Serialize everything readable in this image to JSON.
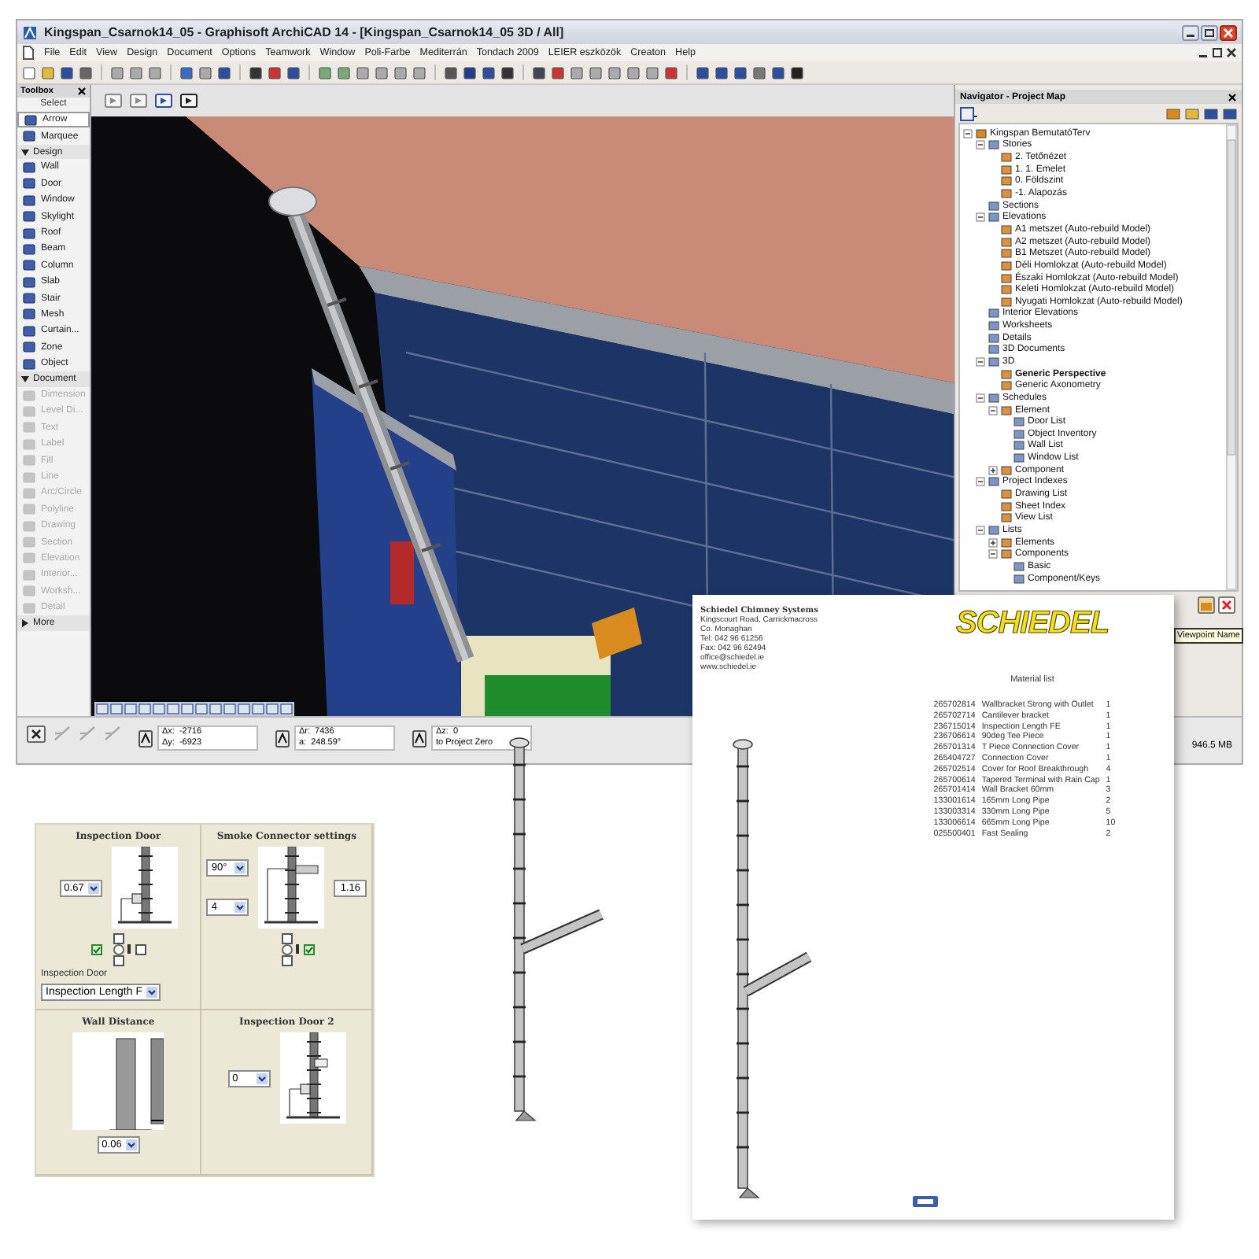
{
  "window": {
    "title": "Kingspan_Csarnok14_05 - Graphisoft ArchiCAD 14 - [Kingspan_Csarnok14_05 3D / All]",
    "menu": [
      "File",
      "Edit",
      "View",
      "Design",
      "Document",
      "Options",
      "Teamwork",
      "Window",
      "Poli-Farbe",
      "Mediterrán",
      "Tondach 2009",
      "LEIER eszközök",
      "Creaton",
      "Help"
    ]
  },
  "toolbox": {
    "title": "Toolbox",
    "items": [
      {
        "kind": "header",
        "label": "Select"
      },
      {
        "kind": "tool",
        "label": "Arrow",
        "selected": true,
        "disabled": false
      },
      {
        "kind": "tool",
        "label": "Marquee",
        "selected": false,
        "disabled": false
      },
      {
        "kind": "section",
        "label": "Design",
        "expanded": true
      },
      {
        "kind": "tool",
        "label": "Wall",
        "selected": false,
        "disabled": false
      },
      {
        "kind": "tool",
        "label": "Door",
        "selected": false,
        "disabled": false
      },
      {
        "kind": "tool",
        "label": "Window",
        "selected": false,
        "disabled": false
      },
      {
        "kind": "tool",
        "label": "Skylight",
        "selected": false,
        "disabled": false
      },
      {
        "kind": "tool",
        "label": "Roof",
        "selected": false,
        "disabled": false
      },
      {
        "kind": "tool",
        "label": "Beam",
        "selected": false,
        "disabled": false
      },
      {
        "kind": "tool",
        "label": "Column",
        "selected": false,
        "disabled": false
      },
      {
        "kind": "tool",
        "label": "Slab",
        "selected": false,
        "disabled": false
      },
      {
        "kind": "tool",
        "label": "Stair",
        "selected": false,
        "disabled": false
      },
      {
        "kind": "tool",
        "label": "Mesh",
        "selected": false,
        "disabled": false
      },
      {
        "kind": "tool",
        "label": "Curtain...",
        "selected": false,
        "disabled": false
      },
      {
        "kind": "tool",
        "label": "Zone",
        "selected": false,
        "disabled": false
      },
      {
        "kind": "tool",
        "label": "Object",
        "selected": false,
        "disabled": false
      },
      {
        "kind": "section",
        "label": "Document",
        "expanded": true
      },
      {
        "kind": "tool",
        "label": "Dimension",
        "selected": false,
        "disabled": true
      },
      {
        "kind": "tool",
        "label": "Level Di...",
        "selected": false,
        "disabled": true
      },
      {
        "kind": "tool",
        "label": "Text",
        "selected": false,
        "disabled": true
      },
      {
        "kind": "tool",
        "label": "Label",
        "selected": false,
        "disabled": true
      },
      {
        "kind": "tool",
        "label": "Fill",
        "selected": false,
        "disabled": true
      },
      {
        "kind": "tool",
        "label": "Line",
        "selected": false,
        "disabled": true
      },
      {
        "kind": "tool",
        "label": "Arc/Circle",
        "selected": false,
        "disabled": true
      },
      {
        "kind": "tool",
        "label": "Polyline",
        "selected": false,
        "disabled": true
      },
      {
        "kind": "tool",
        "label": "Drawing",
        "selected": false,
        "disabled": true
      },
      {
        "kind": "tool",
        "label": "Section",
        "selected": false,
        "disabled": true
      },
      {
        "kind": "tool",
        "label": "Elevation",
        "selected": false,
        "disabled": true
      },
      {
        "kind": "tool",
        "label": "Interior...",
        "selected": false,
        "disabled": true
      },
      {
        "kind": "tool",
        "label": "Worksh...",
        "selected": false,
        "disabled": true
      },
      {
        "kind": "tool",
        "label": "Detail",
        "selected": false,
        "disabled": true
      },
      {
        "kind": "section",
        "label": "More",
        "expanded": false
      }
    ]
  },
  "navigator": {
    "title": "Navigator - Project Map",
    "tree": [
      {
        "label": "Kingspan BemutatóTerv",
        "expanded": true,
        "selected": false,
        "children": [
          {
            "label": "Stories",
            "expanded": true,
            "selected": false,
            "children": [
              {
                "label": "2. Tetőnézet",
                "selected": false
              },
              {
                "label": "1. 1. Emelet",
                "selected": false
              },
              {
                "label": "0. Földszint",
                "selected": false
              },
              {
                "label": "-1. Alapozás",
                "selected": false
              }
            ]
          },
          {
            "label": "Sections",
            "selected": false
          },
          {
            "label": "Elevations",
            "expanded": true,
            "selected": false,
            "children": [
              {
                "label": "A1 metszet (Auto-rebuild Model)",
                "selected": false
              },
              {
                "label": "A2 metszet (Auto-rebuild Model)",
                "selected": false
              },
              {
                "label": "B1 Metszet (Auto-rebuild Model)",
                "selected": false
              },
              {
                "label": "Déli Homlokzat (Auto-rebuild Model)",
                "selected": false
              },
              {
                "label": "Északi Homlokzat (Auto-rebuild Model)",
                "selected": false
              },
              {
                "label": "Keleti Homlokzat (Auto-rebuild Model)",
                "selected": false
              },
              {
                "label": "Nyugati Homlokzat (Auto-rebuild Model)",
                "selected": false
              }
            ]
          },
          {
            "label": "Interior Elevations",
            "selected": false
          },
          {
            "label": "Worksheets",
            "selected": false
          },
          {
            "label": "Details",
            "selected": false
          },
          {
            "label": "3D Documents",
            "selected": false
          },
          {
            "label": "3D",
            "expanded": true,
            "selected": false,
            "children": [
              {
                "label": "Generic Perspective",
                "selected": true
              },
              {
                "label": "Generic Axonometry",
                "selected": false
              }
            ]
          },
          {
            "label": "Schedules",
            "expanded": true,
            "selected": false,
            "children": [
              {
                "label": "Element",
                "expanded": true,
                "selected": false,
                "children": [
                  {
                    "label": "Door List",
                    "selected": false
                  },
                  {
                    "label": "Object Inventory",
                    "selected": false
                  },
                  {
                    "label": "Wall List",
                    "selected": false
                  },
                  {
                    "label": "Window List",
                    "selected": false
                  }
                ]
              },
              {
                "label": "Component",
                "expanded": false,
                "selected": false
              }
            ]
          },
          {
            "label": "Project Indexes",
            "expanded": true,
            "selected": false,
            "children": [
              {
                "label": "Drawing List",
                "selected": false
              },
              {
                "label": "Sheet Index",
                "selected": false
              },
              {
                "label": "View List",
                "selected": false
              }
            ]
          },
          {
            "label": "Lists",
            "expanded": true,
            "selected": false,
            "children": [
              {
                "label": "Elements",
                "expanded": false,
                "selected": false
              },
              {
                "label": "Components",
                "expanded": true,
                "selected": false,
                "children": [
                  {
                    "label": "Basic",
                    "selected": false
                  },
                  {
                    "label": "Component/Keys",
                    "selected": false
                  }
                ]
              }
            ]
          }
        ]
      }
    ],
    "tooltip": "Viewpoint Name"
  },
  "status_bar": {
    "coords": [
      [
        {
          "label": "Δx:",
          "value": "-2716"
        },
        {
          "label": "Δy:",
          "value": "-6923"
        }
      ],
      [
        {
          "label": "Δr:",
          "value": "7436"
        },
        {
          "label": "a:",
          "value": "248.59°"
        }
      ],
      [
        {
          "label": "Δz:",
          "value": "0"
        },
        {
          "label": "to Project Zero"
        }
      ]
    ],
    "memory": "946.5 MB"
  },
  "settings_panel": {
    "sections": [
      {
        "kind": "door",
        "title": "Inspection Door",
        "dropdowns": [
          "0.67"
        ],
        "checkboxes": [
          {
            "kind": "top",
            "checked": false
          },
          {
            "kind": "left",
            "checked": true
          },
          {
            "kind": "right",
            "checked": false
          },
          {
            "kind": "bottom",
            "checked": false
          }
        ],
        "radio_selected": false,
        "label": "Inspection Door",
        "select": "Inspection Length F"
      },
      {
        "kind": "connector",
        "title": "Smoke Connector settings",
        "dropdowns": [
          "90°",
          "4"
        ],
        "field": "1.16",
        "checkboxes": [
          {
            "kind": "top",
            "checked": false
          },
          {
            "kind": "right",
            "checked": true
          },
          {
            "kind": "bottom",
            "checked": false
          }
        ],
        "radio_selected": false
      },
      {
        "kind": "wall",
        "title": "Wall Distance",
        "dropdowns": [
          "0.06"
        ]
      },
      {
        "kind": "door2",
        "title": "Inspection Door 2",
        "dropdowns": [
          "0"
        ]
      }
    ]
  },
  "document": {
    "address": [
      "Schiedel Chimney Systems",
      "Kingscourt Road, Carrickmacross",
      "Co. Monaghan",
      "Tel: 042 96 61256",
      "Fax: 042 96 62494",
      "office@schiedel.ie",
      "www.schiedel.ie"
    ],
    "logo": "SCHIEDEL",
    "list_title": "Material list",
    "rows": [
      [
        "265702814",
        "Wallbracket Strong with Outlet",
        "1"
      ],
      [
        "265702714",
        "Cantilever bracket",
        "1"
      ],
      [
        "236715014",
        "Inspection Length FE",
        "1"
      ],
      [
        "236706614",
        "90deg Tee Piece",
        "1"
      ],
      [
        "265701314",
        "T Piece Connection Cover",
        "1"
      ],
      [
        "265404727",
        "Connection Cover",
        "1"
      ],
      [
        "265702514",
        "Cover for Roof Breakthrough",
        "4"
      ],
      [
        "265700614",
        "Tapered Terminal with Rain Cap",
        "1"
      ],
      [
        "265701414",
        "Wall Bracket 60mm",
        "3"
      ],
      [
        "133001614",
        "165mm Long Pipe",
        "2"
      ],
      [
        "133003314",
        "330mm Long Pipe",
        "5"
      ],
      [
        "133006614",
        "665mm Long Pipe",
        "10"
      ],
      [
        "025500401",
        "Fast Sealing",
        "2"
      ]
    ]
  }
}
